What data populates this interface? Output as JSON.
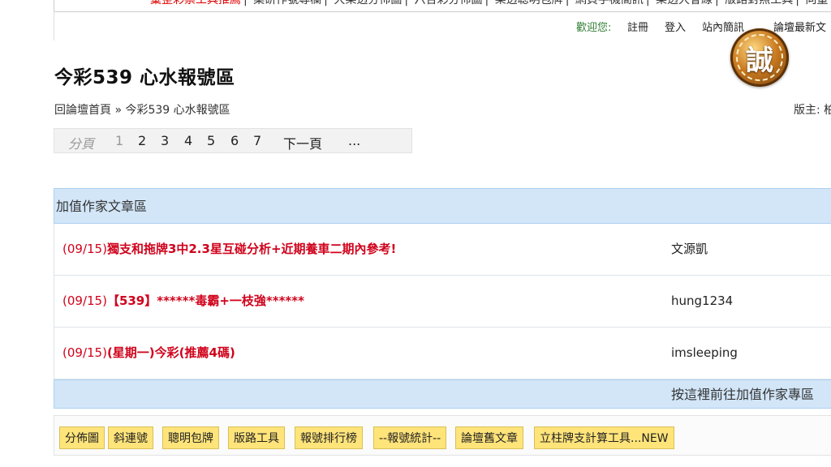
{
  "topnav": {
    "links": [
      "彙整彩票工具推薦",
      "集研作號專欄",
      "大樂透分佈圖",
      "六合彩分佈圖",
      "樂透聰明包牌",
      "網頁手機簡訊",
      "樂透大會線",
      "版路對照工具",
      "向量"
    ]
  },
  "userbar": {
    "welcome": "歡迎您:",
    "register": "註冊",
    "login": "登入",
    "site_intro": "站內簡訊",
    "latest": "論壇最新文"
  },
  "badge": {
    "char": "誠",
    "icon": "seal-badge-icon",
    "color": "#c9791f"
  },
  "page": {
    "title": "今彩539 心水報號區",
    "breadcrumb": "回論壇首頁 » 今彩539 心水報號區",
    "moderator": "版主: 柏"
  },
  "pager": {
    "label": "分頁",
    "pages": [
      "1",
      "2",
      "3",
      "4",
      "5",
      "6",
      "7"
    ],
    "next": "下一頁",
    "more": "..."
  },
  "section": {
    "header": "加值作家文章區",
    "rows": [
      {
        "date": "(09/15)",
        "title": "獨支和拖牌3中2.3星互碰分析+近期養車二期內參考!",
        "author": "文源凱"
      },
      {
        "date": "(09/15)",
        "title": "【539】******毒霸+一枝強******",
        "author": "hung1234"
      },
      {
        "date": "(09/15)",
        "title": "(星期一)今彩(推薦4碼)",
        "author": "imsleeping"
      }
    ],
    "footer": "按這裡前往加值作家專區"
  },
  "toolbar": {
    "buttons": [
      "分佈圖",
      "斜連號",
      "聰明包牌",
      "版路工具",
      "報號排行榜",
      "--報號統計--",
      "論壇舊文章",
      "立柱牌支計算工具...NEW"
    ]
  },
  "colors": {
    "accent_red": "#d0021b",
    "section_blue": "#d2e6f8",
    "button_yellow": "#ffe47a",
    "welcome_green": "#2e7d32"
  }
}
